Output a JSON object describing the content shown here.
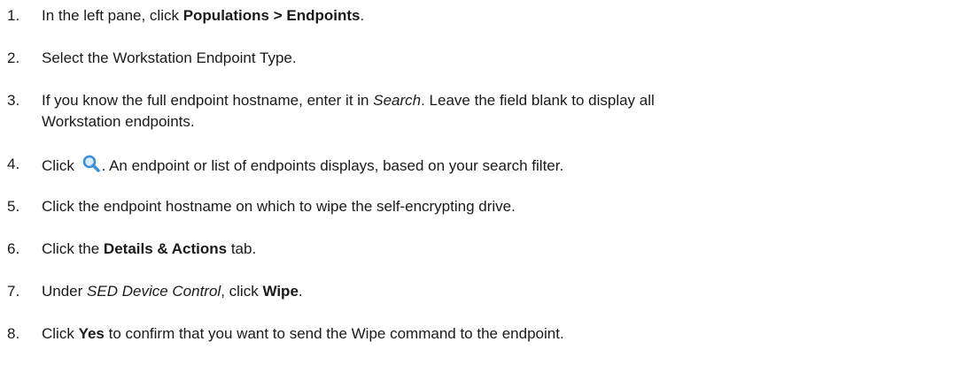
{
  "steps": [
    {
      "number": "1.",
      "parts": {
        "a": "In the left pane, click ",
        "b": "Populations > Endpoints",
        "c": "."
      }
    },
    {
      "number": "2.",
      "parts": {
        "a": "Select the Workstation Endpoint Type."
      }
    },
    {
      "number": "3.",
      "parts": {
        "a": "If you know the full endpoint hostname, enter it in ",
        "b": "Search",
        "c": ". Leave the field blank to display all",
        "d": "Workstation endpoints."
      }
    },
    {
      "number": "4.",
      "parts": {
        "a": "Click ",
        "icon": "search-icon",
        "b": ". An endpoint or list of endpoints displays, based on your search filter."
      }
    },
    {
      "number": "5.",
      "parts": {
        "a": "Click the endpoint hostname on which to wipe the self-encrypting drive."
      }
    },
    {
      "number": "6.",
      "parts": {
        "a": "Click the ",
        "b": "Details & Actions",
        "c": " tab."
      }
    },
    {
      "number": "7.",
      "parts": {
        "a": "Under ",
        "b": "SED Device Control",
        "c": ", click ",
        "d": "Wipe",
        "e": "."
      }
    },
    {
      "number": "8.",
      "parts": {
        "a": "Click ",
        "b": "Yes",
        "c": " to confirm that you want to send the Wipe command to the endpoint."
      }
    }
  ],
  "colors": {
    "text": "#1a1a1a",
    "icon_blue": "#3d8fd6"
  }
}
